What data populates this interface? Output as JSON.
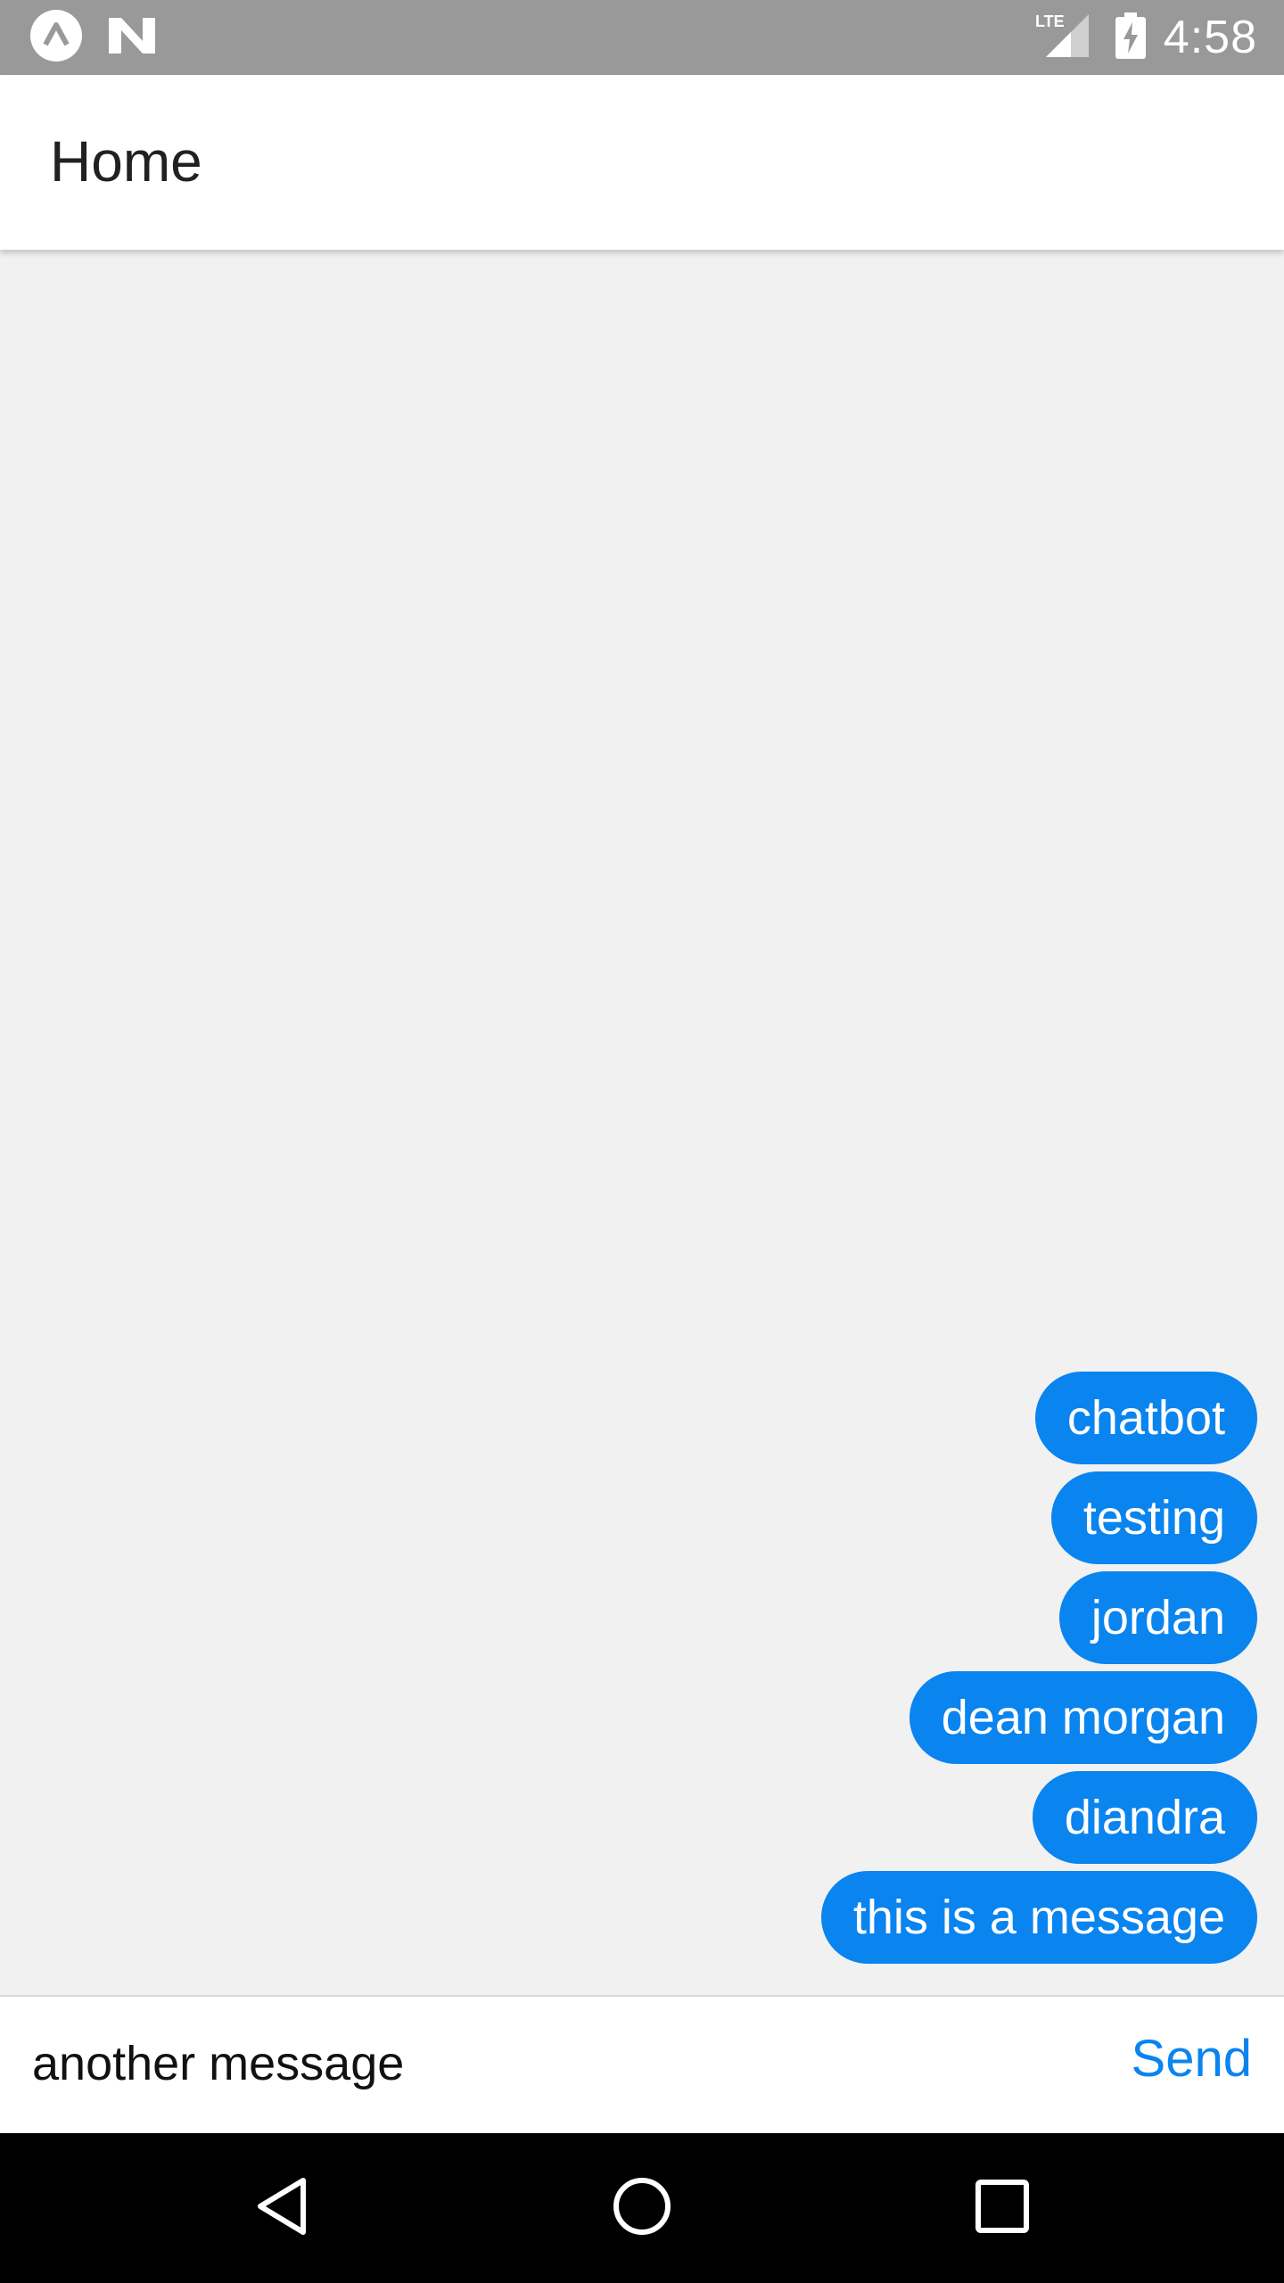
{
  "status_bar": {
    "time": "4:58",
    "network_label": "LTE",
    "icons": [
      "app-notification-icon",
      "n-notification-icon",
      "lte-signal-icon",
      "battery-charging-icon"
    ]
  },
  "app_bar": {
    "title": "Home"
  },
  "messages": [
    {
      "text": "chatbot"
    },
    {
      "text": "testing"
    },
    {
      "text": "jordan"
    },
    {
      "text": "dean morgan"
    },
    {
      "text": "diandra"
    },
    {
      "text": "this is a message"
    }
  ],
  "composer": {
    "value": "another message",
    "send_label": "Send"
  },
  "nav_bar": {
    "icons": [
      "back-icon",
      "home-icon",
      "recents-icon"
    ]
  },
  "colors": {
    "accent": "#0a84ef",
    "status_bar": "#999999",
    "background": "#f1f1f1"
  }
}
